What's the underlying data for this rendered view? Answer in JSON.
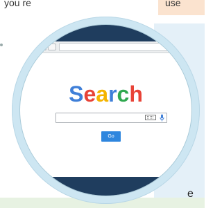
{
  "background": {
    "top_text": "you re",
    "peach_text": "use",
    "bottom_letter": "e"
  },
  "browser": {
    "search_logo": {
      "letters": [
        "S",
        "e",
        "a",
        "r",
        "c",
        "h"
      ],
      "colors": [
        "#3f7fd8",
        "#e84337",
        "#f4b400",
        "#3f7fd8",
        "#2fa84f",
        "#e84337"
      ]
    },
    "search_input": {
      "value": "",
      "placeholder": ""
    },
    "go_button_label": "Go"
  },
  "colors": {
    "frame_dark_blue": "#1f3d5e",
    "magnifier_rim": "#cde6f2",
    "button_blue": "#2e86de"
  }
}
